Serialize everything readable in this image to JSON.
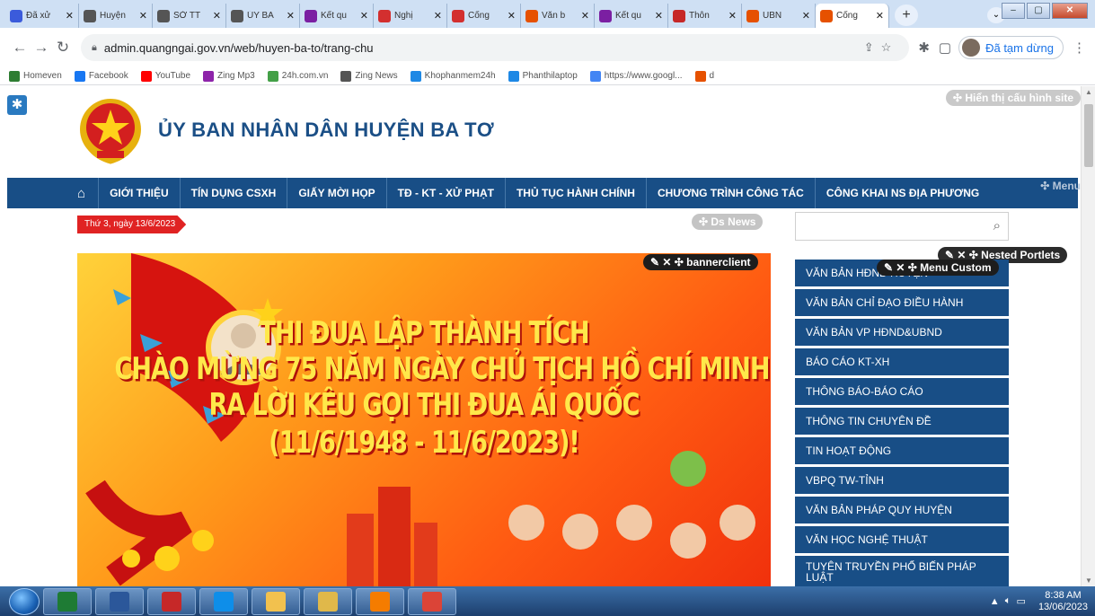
{
  "browser": {
    "tabs": [
      {
        "label": "Đã xử",
        "color": "#3b5bdb"
      },
      {
        "label": "Huyện",
        "color": "#555555"
      },
      {
        "label": "SỞ TT",
        "color": "#555555"
      },
      {
        "label": "ÚY BA",
        "color": "#555555"
      },
      {
        "label": "Kết qu",
        "color": "#7b1fa2"
      },
      {
        "label": "Nghị",
        "color": "#d32f2f"
      },
      {
        "label": "Cổng",
        "color": "#d32f2f"
      },
      {
        "label": "Văn b",
        "color": "#e65100"
      },
      {
        "label": "Kết qu",
        "color": "#7b1fa2"
      },
      {
        "label": "Thôn",
        "color": "#c62828"
      },
      {
        "label": "UBN",
        "color": "#e65100"
      },
      {
        "label": "Cổng",
        "color": "#e65100",
        "active": true
      }
    ],
    "url": "admin.quangngai.gov.vn/web/huyen-ba-to/trang-chu",
    "profile_status": "Đã tạm dừng",
    "bookmarks": [
      {
        "label": "Homeven",
        "color": "#2e7d32"
      },
      {
        "label": "Facebook",
        "color": "#1877f2"
      },
      {
        "label": "YouTube",
        "color": "#ff0000"
      },
      {
        "label": "Zing Mp3",
        "color": "#8e24aa"
      },
      {
        "label": "24h.com.vn",
        "color": "#43a047"
      },
      {
        "label": "Zing News",
        "color": "#555555"
      },
      {
        "label": "Khophanmem24h",
        "color": "#1e88e5"
      },
      {
        "label": "Phanthilaptop",
        "color": "#1e88e5"
      },
      {
        "label": "https://www.googl...",
        "color": "#4285f4"
      },
      {
        "label": "d",
        "color": "#e65100"
      }
    ]
  },
  "site": {
    "config_label": "Hiển thị cấu hình site",
    "title": "ỦY BAN NHÂN DÂN HUYỆN BA TƠ",
    "nav": [
      "GIỚI THIỆU",
      "TÍN DỤNG CSXH",
      "GIẤY MỜI HỌP",
      "TĐ - KT - XỬ PHẠT",
      "THỦ TỤC HÀNH CHÍNH",
      "CHƯƠNG TRÌNH CÔNG TÁC",
      "CÔNG KHAI NS ĐỊA PHƯƠNG"
    ],
    "menu_label": "Menu",
    "date": "Thứ 3, ngày 13/6/2023",
    "ds_news_label": "Ds News",
    "banner_label": "bannerclient",
    "nested_label": "Nested Portlets",
    "menu_custom_label": "Menu Custom",
    "banner": {
      "line1": "THI ĐUA LẬP THÀNH TÍCH",
      "line2": "CHÀO MỪNG 75 NĂM NGÀY CHỦ TỊCH HỒ CHÍ MINH",
      "line3": "RA LỜI KÊU GỌI THI ĐUA ÁI QUỐC",
      "line4": "(11/6/1948 - 11/6/2023)!"
    },
    "sidebar": [
      "VĂN BẢN HĐND HUYỆN",
      "VĂN BẢN CHỈ ĐẠO ĐIỀU HÀNH",
      "VĂN BẢN VP HĐND&UBND",
      "BÁO CÁO KT-XH",
      "THÔNG BÁO-BÁO CÁO",
      "THÔNG TIN CHUYÊN ĐỀ",
      "TIN HOẠT ĐỘNG",
      "VBPQ TW-TỈNH",
      "VĂN BẢN PHÁP QUY HUYỆN",
      "VĂN HỌC NGHỆ THUẬT",
      "TUYÊN TRUYỀN PHỔ BIẾN PHÁP LUẬT"
    ]
  },
  "taskbar": {
    "apps": [
      {
        "name": "excel",
        "color": "#1e7b34"
      },
      {
        "name": "word",
        "color": "#2b579a"
      },
      {
        "name": "acrobat",
        "color": "#c62828"
      },
      {
        "name": "teamviewer",
        "color": "#0e8ee9"
      },
      {
        "name": "explorer-folder",
        "color": "#f2c14e"
      },
      {
        "name": "file-manager",
        "color": "#e0b84a"
      },
      {
        "name": "foxit",
        "color": "#f57c00"
      },
      {
        "name": "chrome",
        "color": "#db4437"
      }
    ],
    "time": "8:38 AM",
    "date": "13/06/2023"
  }
}
